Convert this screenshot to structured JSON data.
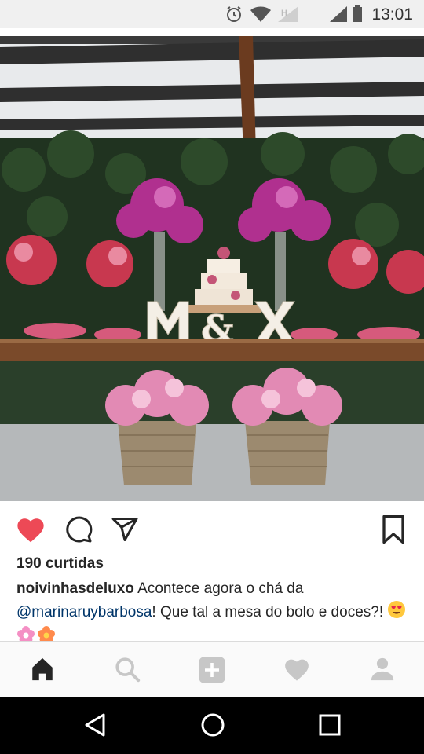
{
  "status_bar": {
    "time": "13:01",
    "icons": [
      "alarm-icon",
      "wifi-icon",
      "h-network-icon",
      "signal-icon",
      "battery-icon"
    ]
  },
  "post": {
    "image_icons": [
      "photo"
    ],
    "likes": "190 curtidas",
    "caption": {
      "username": "noivinhasdeluxo",
      "text_before_mention": " Acontece agora o chá da ",
      "mention": "@marinaruybarbosa",
      "text_after_mention": "! Que tal a mesa do bolo e doces?! ",
      "emojis": [
        "heart-eyes-emoji",
        "pink-flower-emoji",
        "orange-flower-emoji"
      ]
    },
    "actions": [
      "like-heart-icon",
      "comment-icon",
      "share-icon",
      "bookmark-icon"
    ]
  },
  "colors": {
    "like_red": "#ed4956",
    "mention_blue": "#003569",
    "nav_gray": "#c7c7c7",
    "text": "#262626"
  },
  "bottom_nav": [
    "home-icon",
    "search-icon",
    "add-post-icon",
    "activity-heart-icon",
    "profile-icon"
  ],
  "android_nav": [
    "back-icon",
    "home-circle-icon",
    "recents-icon"
  ]
}
